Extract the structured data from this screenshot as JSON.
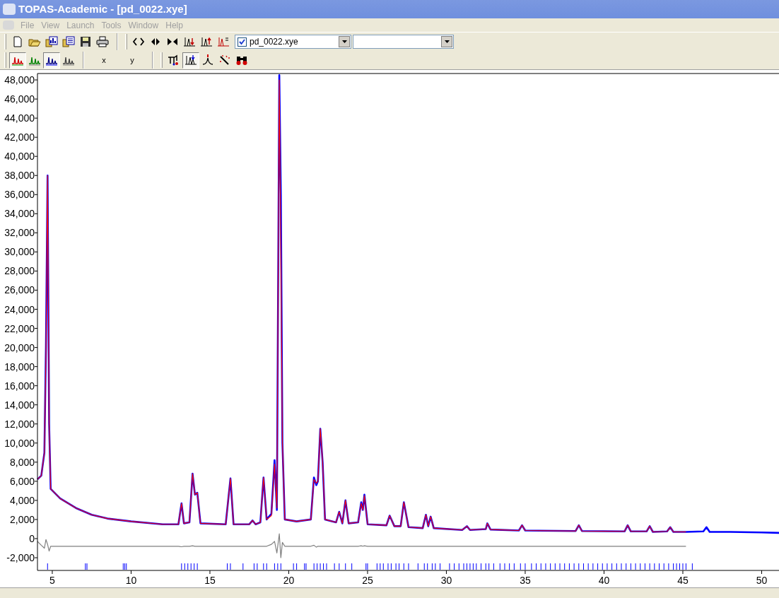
{
  "window": {
    "title": "TOPAS-Academic - [pd_0022.xye]"
  },
  "menu": [
    {
      "label": "File",
      "disabled": true
    },
    {
      "label": "View",
      "disabled": true
    },
    {
      "label": "Launch",
      "disabled": true
    },
    {
      "label": "Tools",
      "disabled": true
    },
    {
      "label": "Window",
      "disabled": true
    },
    {
      "label": "Help",
      "disabled": true
    }
  ],
  "toolbar_1": {
    "buttons": [
      {
        "kind": "new"
      },
      {
        "kind": "open"
      },
      {
        "kind": "chart-doc"
      },
      {
        "kind": "list-doc"
      },
      {
        "kind": "save"
      },
      {
        "kind": "print"
      }
    ],
    "view_buttons": [
      {
        "kind": "expand"
      },
      {
        "kind": "shift"
      },
      {
        "kind": "collapse"
      },
      {
        "kind": "peak-down"
      },
      {
        "kind": "peak-up"
      },
      {
        "kind": "peak-list"
      }
    ],
    "file_selector": {
      "checked": true,
      "value": "pd_0022.xye"
    }
  },
  "toolbar_2": {
    "display_buttons": [
      {
        "kind": "red-peaks",
        "selected": true
      },
      {
        "kind": "green-peaks",
        "selected": false
      },
      {
        "kind": "blue-peaks",
        "selected": true
      },
      {
        "kind": "grey-peaks",
        "selected": false
      }
    ],
    "axis_buttons": [
      {
        "label": "x"
      },
      {
        "label": "y"
      }
    ],
    "tool_buttons": [
      {
        "kind": "fit",
        "selected": false
      },
      {
        "kind": "peak-pick",
        "selected": true
      },
      {
        "kind": "single-peak",
        "selected": false
      },
      {
        "kind": "wand",
        "selected": false
      },
      {
        "kind": "binoculars",
        "selected": false
      }
    ]
  },
  "chart": {
    "chart_data": {
      "type": "line",
      "x": [
        4.06,
        4.3,
        4.5,
        4.6,
        4.7,
        4.8,
        4.9,
        5.5,
        6.5,
        7.5,
        8.5,
        10,
        12,
        13.0,
        13.2,
        13.35,
        13.7,
        13.9,
        14.05,
        14.2,
        14.4,
        16.0,
        16.3,
        16.5,
        17.5,
        17.7,
        17.9,
        18.2,
        18.4,
        18.6,
        18.9,
        19.1,
        19.25,
        19.4,
        19.5,
        19.6,
        19.75,
        20.5,
        21.4,
        21.6,
        21.75,
        21.85,
        22.0,
        22.15,
        22.3,
        23.0,
        23.2,
        23.4,
        23.6,
        23.8,
        24.4,
        24.6,
        24.7,
        24.8,
        25.0,
        26.2,
        26.4,
        26.7,
        27.1,
        27.3,
        27.6,
        28.5,
        28.7,
        28.85,
        29.0,
        29.2,
        31.0,
        31.3,
        31.5,
        32.5,
        32.6,
        32.8,
        34.6,
        34.8,
        35.0,
        38.2,
        38.4,
        38.6,
        41.3,
        41.5,
        41.7,
        42.7,
        42.9,
        43.1,
        44.0,
        44.2,
        44.4,
        45.2,
        46.3,
        46.5,
        46.7,
        48,
        50,
        51.1
      ],
      "series": [
        {
          "color": "#0000ff",
          "values": [
            6200,
            6600,
            9000,
            20000,
            38000,
            12000,
            5200,
            4200,
            3200,
            2500,
            2100,
            1800,
            1500,
            1500,
            3700,
            1600,
            1700,
            6800,
            4600,
            4800,
            1600,
            1500,
            6300,
            1500,
            1500,
            1900,
            1500,
            1700,
            6400,
            2000,
            2600,
            8200,
            3000,
            48500,
            36000,
            10000,
            2000,
            1800,
            2000,
            6400,
            5600,
            6000,
            11500,
            8000,
            2000,
            1700,
            2800,
            1600,
            4000,
            1600,
            1700,
            3800,
            3000,
            4600,
            1500,
            1400,
            2400,
            1300,
            1300,
            3800,
            1200,
            1100,
            2500,
            1300,
            2300,
            1100,
            900,
            1300,
            900,
            1000,
            1600,
            950,
            850,
            1400,
            850,
            800,
            1400,
            800,
            750,
            1400,
            750,
            750,
            1300,
            700,
            750,
            1200,
            700,
            700,
            750,
            1200,
            700,
            700,
            650,
            600
          ]
        },
        {
          "color": "#ff0000",
          "values": [
            6200,
            6600,
            9000,
            19500,
            38000,
            12000,
            5200,
            4200,
            3200,
            2500,
            2100,
            1800,
            1500,
            1500,
            3700,
            1600,
            1700,
            6800,
            4600,
            4800,
            1600,
            1500,
            6300,
            1500,
            1500,
            1900,
            1500,
            1700,
            6400,
            2000,
            2400,
            7800,
            3200,
            48000,
            30000,
            10000,
            2000,
            1800,
            2000,
            6200,
            5800,
            6000,
            11500,
            8000,
            2000,
            1700,
            2800,
            1600,
            4000,
            1600,
            1700,
            3700,
            3000,
            4500,
            1500,
            1400,
            2400,
            1300,
            1300,
            3800,
            1200,
            1100,
            2500,
            1300,
            2300,
            1100,
            900,
            1300,
            900,
            1000,
            1600,
            950,
            850,
            1400,
            850,
            800,
            1400,
            800,
            750,
            1400,
            750,
            750,
            1300,
            700,
            750,
            1200,
            700,
            700,
            null,
            null,
            null,
            null,
            null,
            null
          ]
        },
        {
          "color": "#808080",
          "values": [
            -300,
            -700,
            -1000,
            -100,
            -600,
            -1300,
            -800,
            -800,
            -800,
            -800,
            -800,
            -800,
            -800,
            -800,
            -850,
            -800,
            -800,
            -750,
            -800,
            -800,
            -800,
            -800,
            -800,
            -800,
            -800,
            -800,
            -800,
            -800,
            -800,
            -800,
            -600,
            -300,
            -1500,
            500,
            -2000,
            -400,
            -800,
            -800,
            -800,
            -700,
            -900,
            -800,
            -800,
            -800,
            -800,
            -800,
            -800,
            -800,
            -800,
            -800,
            -800,
            -750,
            -800,
            -750,
            -800,
            -800,
            -800,
            -800,
            -800,
            -800,
            -800,
            -800,
            -800,
            -800,
            -800,
            -800,
            -800,
            -800,
            -800,
            -800,
            -800,
            -800,
            -800,
            -800,
            -800,
            -800,
            -800,
            -800,
            -800,
            -800,
            -800,
            -800,
            -800,
            -800,
            -800,
            -800,
            -800,
            -800,
            null,
            null,
            null,
            null,
            null,
            null
          ]
        }
      ],
      "xlim": [
        4.06,
        51.1
      ],
      "ylim": [
        -3330,
        48670
      ],
      "xticks": [
        5,
        10,
        15,
        20,
        25,
        30,
        35,
        40,
        45,
        50
      ],
      "yticks": [
        {
          "value": -2000,
          "label": "-2,000"
        },
        {
          "value": 0,
          "label": "0"
        },
        {
          "value": 2000,
          "label": "2,000"
        },
        {
          "value": 4000,
          "label": "4,000"
        },
        {
          "value": 6000,
          "label": "6,000"
        },
        {
          "value": 8000,
          "label": "8,000"
        },
        {
          "value": 10000,
          "label": "10,000"
        },
        {
          "value": 12000,
          "label": "12,000"
        },
        {
          "value": 14000,
          "label": "14,000"
        },
        {
          "value": 16000,
          "label": "16,000"
        },
        {
          "value": 18000,
          "label": "18,000"
        },
        {
          "value": 20000,
          "label": "20,000"
        },
        {
          "value": 22000,
          "label": "22,000"
        },
        {
          "value": 24000,
          "label": "24,000"
        },
        {
          "value": 26000,
          "label": "26,000"
        },
        {
          "value": 28000,
          "label": "28,000"
        },
        {
          "value": 30000,
          "label": "30,000"
        },
        {
          "value": 32000,
          "label": "32,000"
        },
        {
          "value": 34000,
          "label": "34,000"
        },
        {
          "value": 36000,
          "label": "36,000"
        },
        {
          "value": 38000,
          "label": "38,000"
        },
        {
          "value": 40000,
          "label": "40,000"
        },
        {
          "value": 42000,
          "label": "42,000"
        },
        {
          "value": 44000,
          "label": "44,000"
        },
        {
          "value": 46000,
          "label": "46,000"
        },
        {
          "value": 48000,
          "label": "48,000"
        }
      ]
    }
  }
}
